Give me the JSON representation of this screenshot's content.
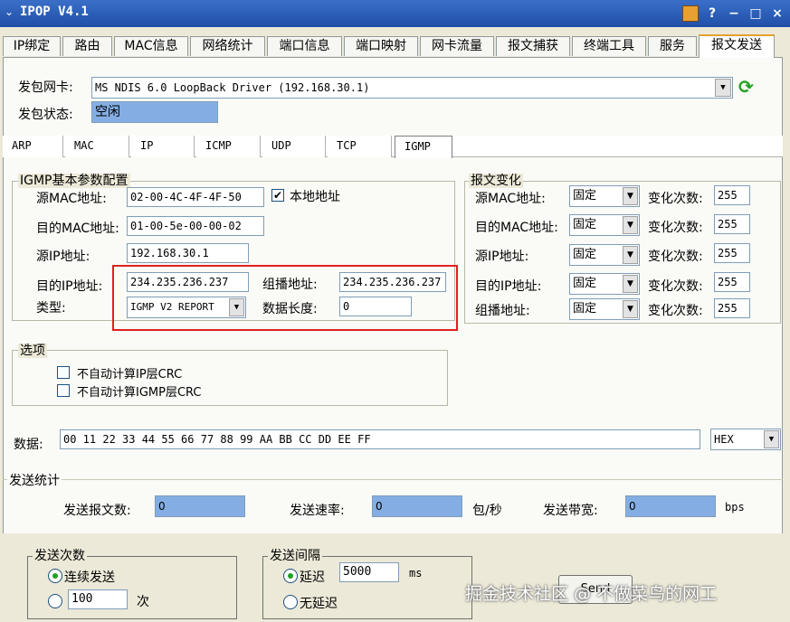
{
  "app": {
    "title": "IPOP V4.1",
    "app_icon": "chevron-icon",
    "window_buttons": [
      "?",
      "-",
      "□",
      "×"
    ]
  },
  "tabs": [
    "IP绑定",
    "路由",
    "MAC信息",
    "网络统计",
    "端口信息",
    "端口映射",
    "网卡流量",
    "报文捕获",
    "终端工具",
    "服务",
    "报文发送"
  ],
  "active_tab": "报文发送",
  "nic": {
    "label": "发包网卡:",
    "value": "MS NDIS 6.0 LoopBack Driver (192.168.30.1)"
  },
  "status": {
    "label": "发包状态:",
    "value": "空闲"
  },
  "proto_tabs": [
    "ARP",
    "MAC",
    "IP",
    "ICMP",
    "UDP",
    "TCP",
    "IGMP"
  ],
  "active_proto_tab": "IGMP",
  "igmp": {
    "title": "IGMP基本参数配置",
    "src_mac_label": "源MAC地址:",
    "src_mac": "02-00-4C-4F-4F-50",
    "local_label": "本地地址",
    "local_checked": "✔",
    "dst_mac_label": "目的MAC地址:",
    "dst_mac": "01-00-5e-00-00-02",
    "src_ip_label": "源IP地址:",
    "src_ip": "192.168.30.1",
    "dst_ip_label": "目的IP地址:",
    "dst_ip": "234.235.236.237",
    "group_label": "组播地址:",
    "group_addr": "234.235.236.237",
    "type_label": "类型:",
    "type": "IGMP V2 REPORT",
    "len_label": "数据长度:",
    "len": "0"
  },
  "change": {
    "title": "报文变化",
    "rows": [
      {
        "label": "源MAC地址:",
        "mode": "固定",
        "count_label": "变化次数:",
        "count": "255"
      },
      {
        "label": "目的MAC地址:",
        "mode": "固定",
        "count_label": "变化次数:",
        "count": "255"
      },
      {
        "label": "源IP地址:",
        "mode": "固定",
        "count_label": "变化次数:",
        "count": "255"
      },
      {
        "label": "目的IP地址:",
        "mode": "固定",
        "count_label": "变化次数:",
        "count": "255"
      },
      {
        "label": "组播地址:",
        "mode": "固定",
        "count_label": "变化次数:",
        "count": "255"
      }
    ]
  },
  "options": {
    "title": "选项",
    "items": [
      "不自动计算IP层CRC",
      "不自动计算IGMP层CRC"
    ]
  },
  "data": {
    "label": "数据:",
    "value": "00 11 22 33 44 55 66 77 88 99 AA BB CC DD EE FF",
    "format": "HEX"
  },
  "stats": {
    "title": "发送统计",
    "sent_label": "发送报文数:",
    "sent": "0",
    "rate_label": "发送速率:",
    "rate": "0",
    "rate_unit": "包/秒",
    "bw_label": "发送带宽:",
    "bw": "0",
    "bw_unit": "bps"
  },
  "send_count": {
    "title": "发送次数",
    "continuous": "连续发送",
    "count": "100",
    "unit": "次"
  },
  "interval": {
    "title": "发送间隔",
    "delay": "延迟",
    "delay_value": "5000",
    "unit": "ms",
    "no_delay": "无延迟"
  },
  "send_button": "Send",
  "watermark": "掘金技术社区 @ 不做菜鸟的网工",
  "colors": {
    "title_bar": "#1f4fa8",
    "highlight_box": "#e02020",
    "status_fill": "#84aee3",
    "refresh": "#21a121"
  }
}
